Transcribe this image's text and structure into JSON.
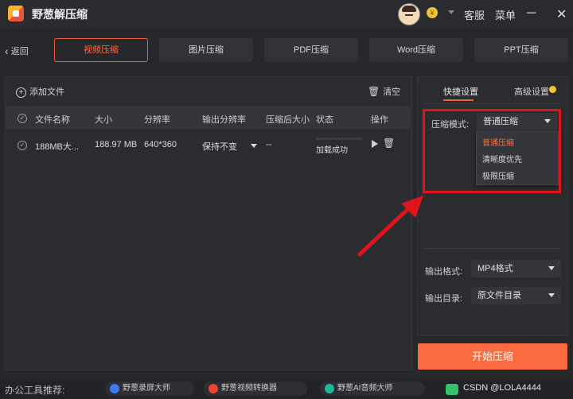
{
  "app": {
    "title": "野葱解压缩"
  },
  "header": {
    "coin": "¥",
    "service": "客服",
    "menu": "菜单",
    "minimize": "─",
    "close": "✕"
  },
  "nav": {
    "back": "返回",
    "tabs": [
      {
        "label": "视频压缩",
        "active": true
      },
      {
        "label": "图片压缩"
      },
      {
        "label": "PDF压缩"
      },
      {
        "label": "Word压缩"
      },
      {
        "label": "PPT压缩"
      }
    ]
  },
  "files": {
    "add": "添加文件",
    "clear": "清空",
    "columns": [
      "文件名称",
      "大小",
      "分辨率",
      "输出分辨率",
      "压缩后大小",
      "状态",
      "操作"
    ],
    "rows": [
      {
        "name": "188MB大...",
        "size": "188.97 MB",
        "resolution": "640*360",
        "output": "保持不变",
        "compressed": "--",
        "status": "加载成功"
      }
    ]
  },
  "settings": {
    "tab_quick": "快捷设置",
    "tab_advanced": "高级设置",
    "mode_label": "压缩模式:",
    "mode_value": "普通压缩",
    "mode_options": [
      "普通压缩",
      "清晰度优先",
      "极限压缩"
    ],
    "format_label": "输出格式:",
    "format_value": "MP4格式",
    "dir_label": "输出目录:",
    "dir_value": "原文件目录",
    "start": "开始压缩"
  },
  "bottom": {
    "recommend": "办公工具推荐:",
    "tools": [
      "野葱录屏大师",
      "野葱视频转换器",
      "野葱AI音频大师"
    ],
    "watermark": "CSDN @LOLA4444"
  },
  "colors": {
    "accent": "#fb6b3f",
    "highlight": "#e0141d"
  }
}
